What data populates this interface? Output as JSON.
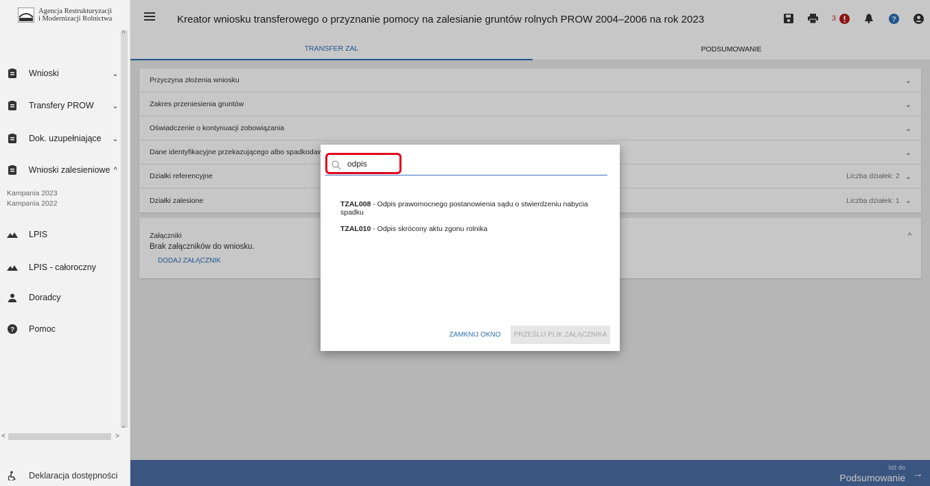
{
  "logo": {
    "line1": "Agencja Restrukturyzacji",
    "line2": "i Modernizacji Rolnictwa"
  },
  "sidebar": {
    "items": [
      {
        "label": "Wnioski",
        "chevron": "⌄"
      },
      {
        "label": "Transfery PROW",
        "chevron": "⌄"
      },
      {
        "label": "Dok. uzupełniające",
        "chevron": "⌄"
      },
      {
        "label": "Wnioski zalesieniowe",
        "chevron": "^"
      },
      {
        "label": "LPIS"
      },
      {
        "label": "LPIS - całoroczny"
      },
      {
        "label": "Doradcy"
      },
      {
        "label": "Pomoc"
      }
    ],
    "sub_items": [
      "Kampania 2023",
      "Kampania 2022"
    ],
    "footer": "Deklaracja dostępności"
  },
  "header": {
    "title": "Kreator wniosku transferowego o przyznanie pomocy na zalesianie gruntów rolnych PROW 2004–2006 na rok 2023",
    "error_count": "3"
  },
  "tabs": [
    "TRANSFER ZAL",
    "PODSUMOWANIE"
  ],
  "sections": [
    {
      "label": "Przyczyna złożenia wniosku",
      "right": ""
    },
    {
      "label": "Zakres przeniesienia gruntów",
      "right": ""
    },
    {
      "label": "Oświadczenie o kontynuacji zobowiązania",
      "right": ""
    },
    {
      "label": "Dane identyfikacyjne przekazującego albo spadkodawcy",
      "right": ""
    },
    {
      "label": "Działki referencyjne",
      "right": "Liczba działek: 2"
    },
    {
      "label": "Działki zalesione",
      "right": "Liczba działek: 1"
    }
  ],
  "attachments": {
    "title": "Załączniki",
    "empty": "Brak załączników do wniosku.",
    "add_label": "DODAJ ZAŁĄCZNIK"
  },
  "bottom": {
    "goto_small": "Idź do",
    "goto_main": "Podsumowanie"
  },
  "dialog": {
    "search_value": "odpis",
    "results": [
      {
        "code": "TZAL008",
        "text": " - Odpis prawomocnego postanowienia sądu o stwierdzeniu nabycia spadku"
      },
      {
        "code": "TZAL010",
        "text": " - Odpis skrócony aktu zgonu rolnika"
      }
    ],
    "close_label": "ZAMKNIJ OKNO",
    "send_label": "PRZEŚLIJ PLIK ZAŁĄCZNIKA"
  },
  "colors": {
    "accent": "#2a6db5",
    "bottom_bar": "#4b6da3",
    "highlight": "#e3001b",
    "error": "#c62828"
  }
}
